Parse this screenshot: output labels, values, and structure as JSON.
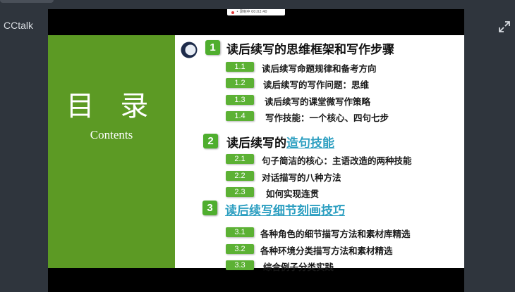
{
  "app": {
    "name": "CCtalk"
  },
  "recording": {
    "label": "• 录制中 00:02:40"
  },
  "slide": {
    "left_title": "目 录",
    "left_subtitle": "Contents",
    "sections": [
      {
        "num": "1",
        "title": "读后续写的思维框架和写作步骤",
        "title_linked": "",
        "items": [
          {
            "num": "1.1",
            "text": "读后续写命题规律和备考方向"
          },
          {
            "num": "1.2",
            "text": "读后续写的写作问题：思维"
          },
          {
            "num": "1.3",
            "text": "读后续写的课堂微写作策略"
          },
          {
            "num": "1.4",
            "text": "写作技能：一个核心、四句七步"
          }
        ]
      },
      {
        "num": "2",
        "title": "读后续写的",
        "title_linked": "造句技能",
        "items": [
          {
            "num": "2.1",
            "text": "句子简洁的核心：主语改造的两种技能"
          },
          {
            "num": "2.2",
            "text": "对话描写的八种方法"
          },
          {
            "num": "2.3",
            "text": "如何实现连贯"
          }
        ]
      },
      {
        "num": "3",
        "title": "",
        "title_linked": "读后续写细节刻画技巧",
        "items": [
          {
            "num": "3.1",
            "text": "各种角色的细节描写方法和素材库精选"
          },
          {
            "num": "3.2",
            "text": "各种环境分类描写方法和素材精选"
          },
          {
            "num": "3.3",
            "text": "综合例子分类实践"
          }
        ]
      }
    ]
  },
  "icons": {
    "expand": "expand-icon",
    "circle": "circle-bullet-icon"
  },
  "colors": {
    "green_panel": "#5c9a24",
    "number_box": "#5cb134",
    "link": "#2d9fc1"
  }
}
